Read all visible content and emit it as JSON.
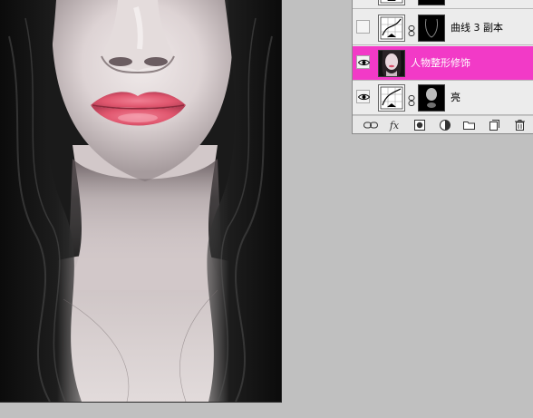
{
  "layers": [
    {
      "name": "",
      "visible": false,
      "type": "curves-with-mask"
    },
    {
      "name": "曲线 3 副本",
      "visible": false,
      "type": "curves-with-mask"
    },
    {
      "name": "人物整形修饰",
      "visible": true,
      "selected": true,
      "type": "pixel"
    },
    {
      "name": "亮",
      "visible": true,
      "type": "curves-with-mask"
    }
  ],
  "footer": {
    "fx_label": "fx"
  },
  "colors": {
    "selected_layer": "#f23ac7",
    "panel_bg": "#ececec",
    "workspace_bg": "#c0c0c0",
    "lips": "#e0566e"
  },
  "icons": [
    "eye-icon",
    "chain-icon",
    "curves-thumbnail-icon",
    "link-layers-icon",
    "layer-style-icon",
    "add-mask-icon",
    "adjustment-layer-icon",
    "new-group-icon",
    "new-layer-icon",
    "trash-icon"
  ]
}
